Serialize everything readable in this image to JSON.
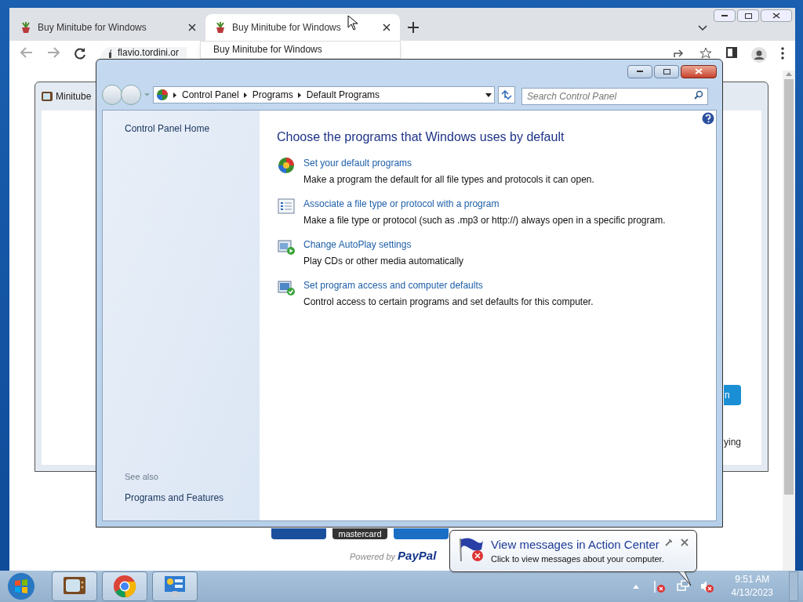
{
  "browser": {
    "tabs": [
      {
        "title": "Buy Minitube for Windows",
        "selected": false
      },
      {
        "title": "Buy Minitube for Windows",
        "selected": true
      }
    ],
    "tab_hover_card": "Buy Minitube for Windows",
    "address": "flavio.tordini.or",
    "page": {
      "dialog_title": "Minitube",
      "button_text": "n",
      "side_text": "ying",
      "card_label": "mastercard",
      "powered_by": "Powered by",
      "paypal": "PayPal"
    }
  },
  "control_panel": {
    "breadcrumb": [
      "Control Panel",
      "Programs",
      "Default Programs"
    ],
    "search_placeholder": "Search Control Panel",
    "sidebar": {
      "home": "Control Panel Home",
      "see_also_title": "See also",
      "see_also": [
        "Programs and Features"
      ]
    },
    "heading": "Choose the programs that Windows uses by default",
    "tasks": [
      {
        "kind": "defaults",
        "link": "Set your default programs",
        "description": "Make a program the default for all file types and protocols it can open."
      },
      {
        "kind": "associate",
        "link": "Associate a file type or protocol with a program",
        "description": "Make a file type or protocol (such as .mp3 or http://) always open in a specific program."
      },
      {
        "kind": "autoplay",
        "link": "Change AutoPlay settings",
        "description": "Play CDs or other media automatically"
      },
      {
        "kind": "access",
        "link": "Set program access and computer defaults",
        "description": "Control access to certain programs and set defaults for this computer."
      }
    ]
  },
  "notification": {
    "title": "View messages in Action Center",
    "body": "Click to view messages about your computer."
  },
  "taskbar": {
    "apps": [
      {
        "kind": "tv"
      },
      {
        "kind": "chrome"
      },
      {
        "kind": "control-panel"
      }
    ],
    "clock": {
      "time": "9:51 AM",
      "date": "4/13/2023"
    }
  }
}
